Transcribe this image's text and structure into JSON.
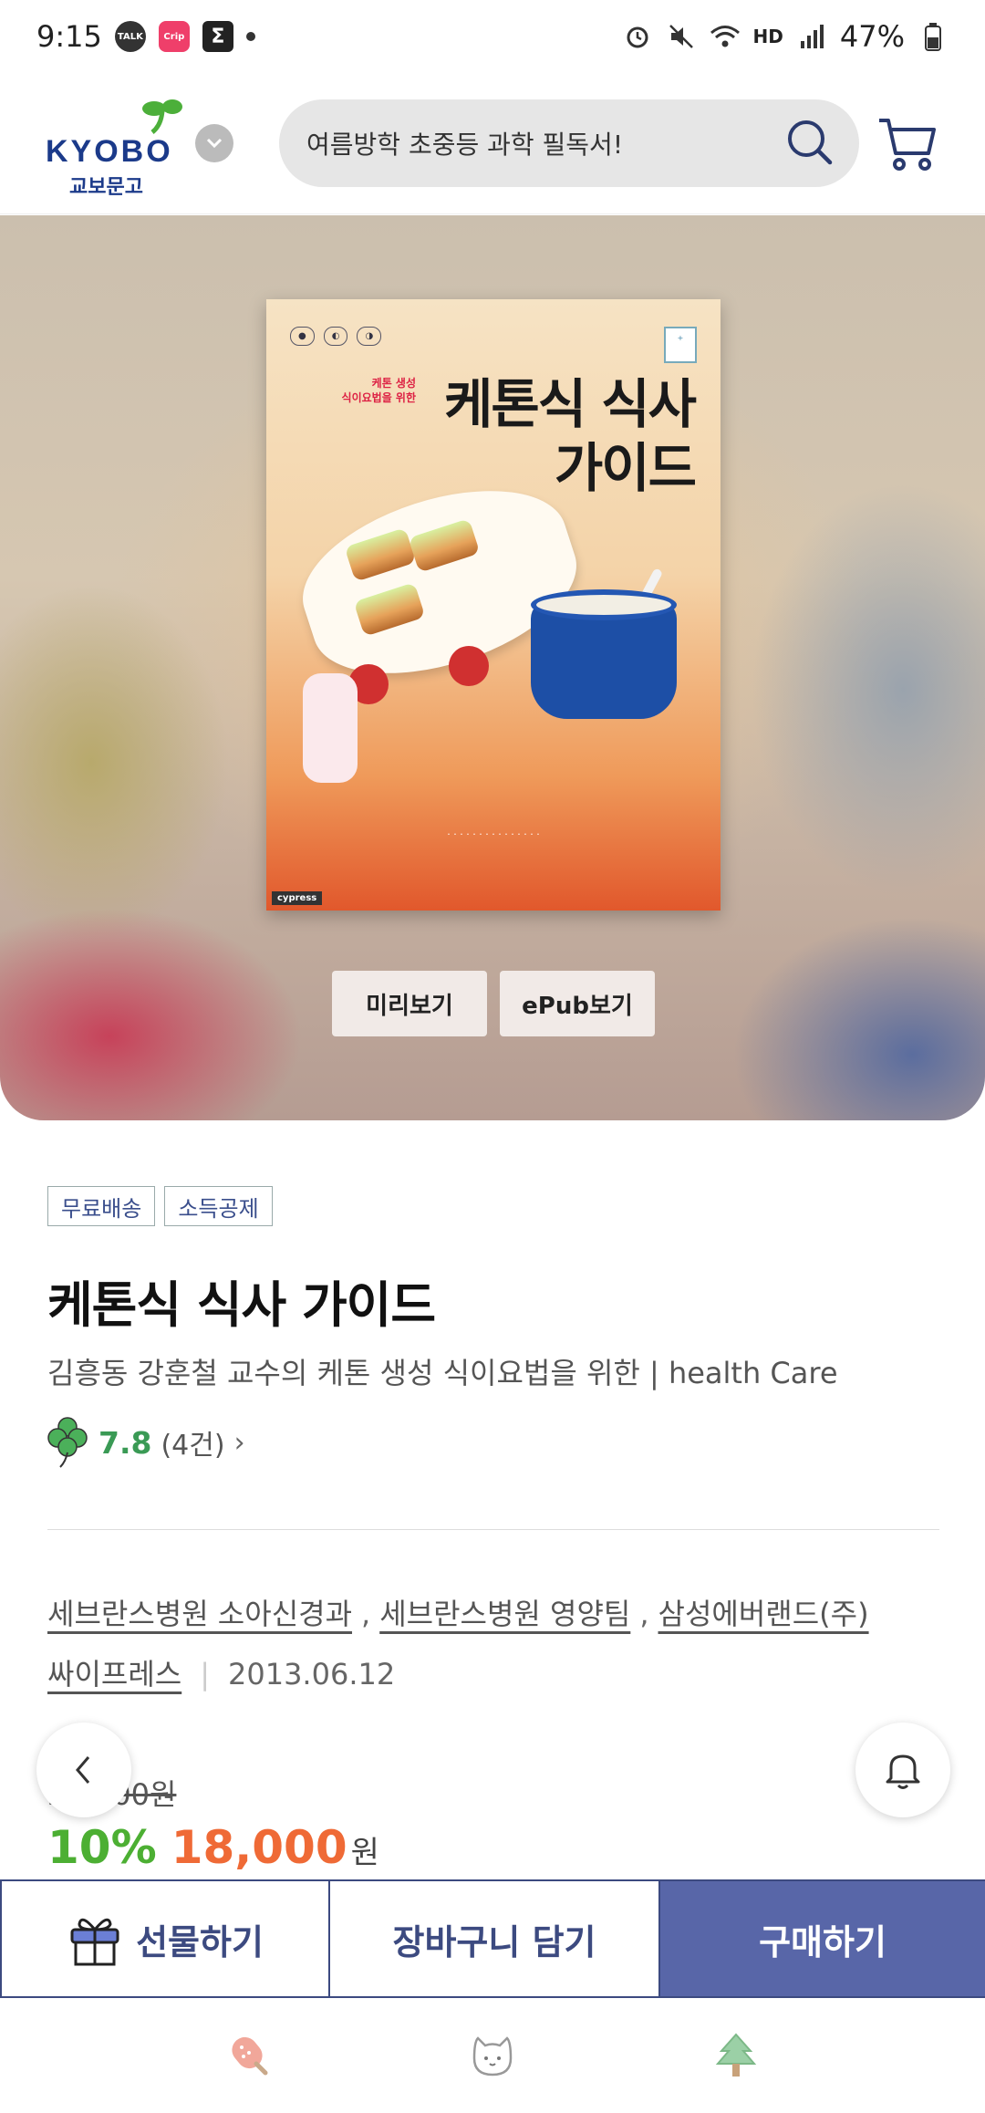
{
  "status_bar": {
    "time": "9:15",
    "battery": "47%",
    "hd_label": "HD",
    "talk_label": "TALK",
    "app_label": "Crip"
  },
  "header": {
    "logo_text": "KYOBO",
    "logo_text_ko": "교보문고",
    "search": {
      "value": "여름방학 초중등 과학 필독서!"
    }
  },
  "hero": {
    "preview_label": "미리보기",
    "epub_label": "ePub보기",
    "cover": {
      "title_line1": "케톤식 식사",
      "title_line2": "가이드",
      "small_line1": "케톤 생성",
      "small_line2": "식이요법을 위한",
      "publisher_mark": "cypress"
    }
  },
  "product": {
    "tags": [
      "무료배송",
      "소득공제"
    ],
    "title": "케톤식 식사 가이드",
    "subtitle": "김흥동 강훈철 교수의 케톤 생성 식이요법을 위한 | health Care",
    "rating_score": "7.8",
    "rating_count": "(4건)",
    "authors": [
      "세브란스병원 소아신경과",
      "세브란스병원 영양팀",
      "삼성에버랜드(주)"
    ],
    "publisher": "싸이프레스",
    "date": "2013.06.12",
    "original_price": "20,000원",
    "discount": "10%",
    "price": "18,000",
    "price_unit": "원"
  },
  "actions": {
    "gift_label": "선물하기",
    "cart_label": "장바구니 담기",
    "buy_label": "구매하기"
  },
  "icons": [
    "chevron-left-icon",
    "bell-icon",
    "search-icon",
    "cart-icon",
    "gift-icon",
    "popsicle-icon",
    "cat-face-icon",
    "tree-icon"
  ],
  "colors": {
    "brand_navy": "#3c4a80",
    "buy_bg": "#5866a8",
    "discount_green": "#4caf33",
    "price_orange": "#ef6a36",
    "rating_green": "#3a9a55"
  }
}
